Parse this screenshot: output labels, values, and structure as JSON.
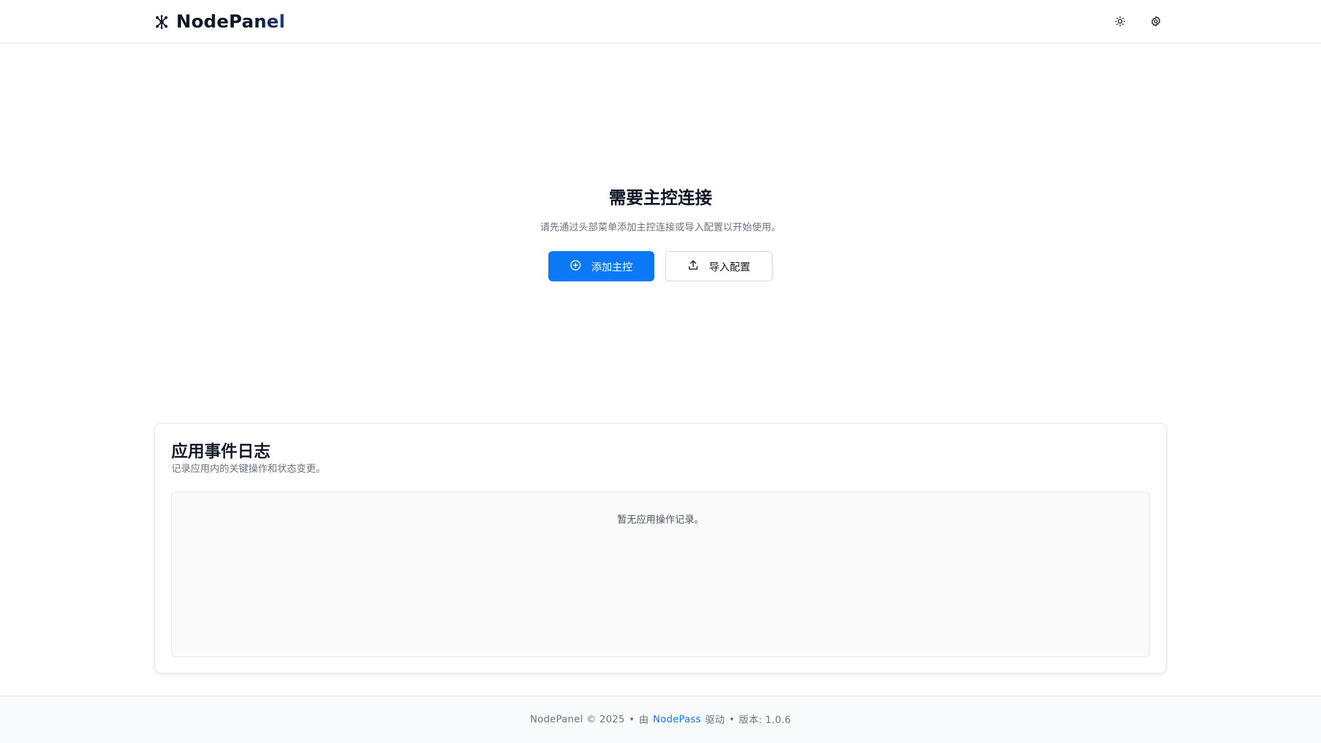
{
  "header": {
    "brand_name": "NodePanel",
    "brand_icon": "cluster-nodes-icon",
    "actions": [
      {
        "icon": "sun-icon",
        "label": "theme-toggle"
      },
      {
        "icon": "gear-icon",
        "label": "settings"
      }
    ]
  },
  "empty_state": {
    "title": "需要主控连接",
    "description": "请先通过头部菜单添加主控连接或导入配置以开始使用。",
    "primary_button": {
      "label": "添加主控",
      "icon": "plus-circle-icon"
    },
    "secondary_button": {
      "label": "导入配置",
      "icon": "upload-icon"
    }
  },
  "event_log": {
    "title": "应用事件日志",
    "subtitle": "记录应用内的关键操作和状态变更。",
    "empty_text": "暂无应用操作记录。"
  },
  "footer": {
    "copyright": "NodePanel © 2025",
    "separator": "•",
    "powered_prefix": "由",
    "powered_link": "NodePass",
    "powered_suffix": "驱动",
    "version_label": "版本: 1.0.6"
  },
  "colors": {
    "primary": "#0b78f5",
    "border": "#e5e7eb",
    "muted_text": "#6b7280"
  }
}
